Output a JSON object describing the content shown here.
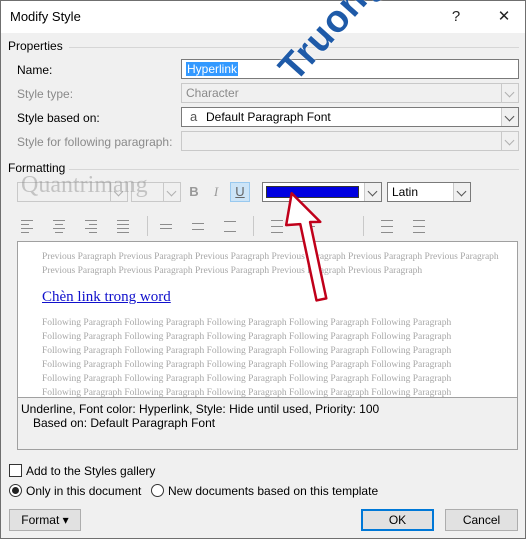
{
  "dialog": {
    "title": "Modify Style",
    "help_glyph": "?",
    "close_glyph": "✕"
  },
  "properties": {
    "heading": "Properties",
    "name_label": "Name:",
    "name_value": "Hyperlink",
    "style_type_label": "Style type:",
    "style_type_value": "Character",
    "based_on_label": "Style based on:",
    "based_on_icon_glyph": "a",
    "based_on_value": "Default Paragraph Font",
    "following_label": "Style for following paragraph:",
    "following_value": ""
  },
  "formatting": {
    "heading": "Formatting",
    "bold_label": "B",
    "italic_label": "I",
    "underline_label": "U",
    "font_color": "#0000e0",
    "script_value": "Latin"
  },
  "preview": {
    "previous_lines": [
      "Previous Paragraph Previous Paragraph Previous Paragraph Previous Paragraph Previous Paragraph Previous Paragraph",
      "Previous Paragraph Previous Paragraph Previous Paragraph Previous Paragraph Previous Paragraph"
    ],
    "sample_text": "Chèn link trong word",
    "following_lines": [
      "Following Paragraph Following Paragraph Following Paragraph Following Paragraph Following Paragraph",
      "Following Paragraph Following Paragraph Following Paragraph Following Paragraph Following Paragraph",
      "Following Paragraph Following Paragraph Following Paragraph Following Paragraph Following Paragraph",
      "Following Paragraph Following Paragraph Following Paragraph Following Paragraph Following Paragraph",
      "Following Paragraph Following Paragraph Following Paragraph Following Paragraph Following Paragraph",
      "Following Paragraph Following Paragraph Following Paragraph Following Paragraph Following Paragraph"
    ]
  },
  "description": {
    "line1": "Underline, Font color: Hyperlink, Style: Hide until used, Priority: 100",
    "line2": "Based on: Default Paragraph Font"
  },
  "options": {
    "add_to_gallery_label": "Add to the Styles gallery",
    "add_to_gallery_checked": false,
    "only_this_doc_label": "Only in this document",
    "new_docs_label": "New documents based on this template",
    "selected_scope": "only_this_document"
  },
  "buttons": {
    "format_label": "Format",
    "format_arrow": "▾",
    "ok_label": "OK",
    "cancel_label": "Cancel"
  },
  "watermarks": {
    "brand_text": "Quantrimang",
    "site_text": "Truongtin.top",
    "site_color": "#1e5aa8",
    "site_accent_color": "#e8742a",
    "arrow_color": "#c0001a"
  }
}
